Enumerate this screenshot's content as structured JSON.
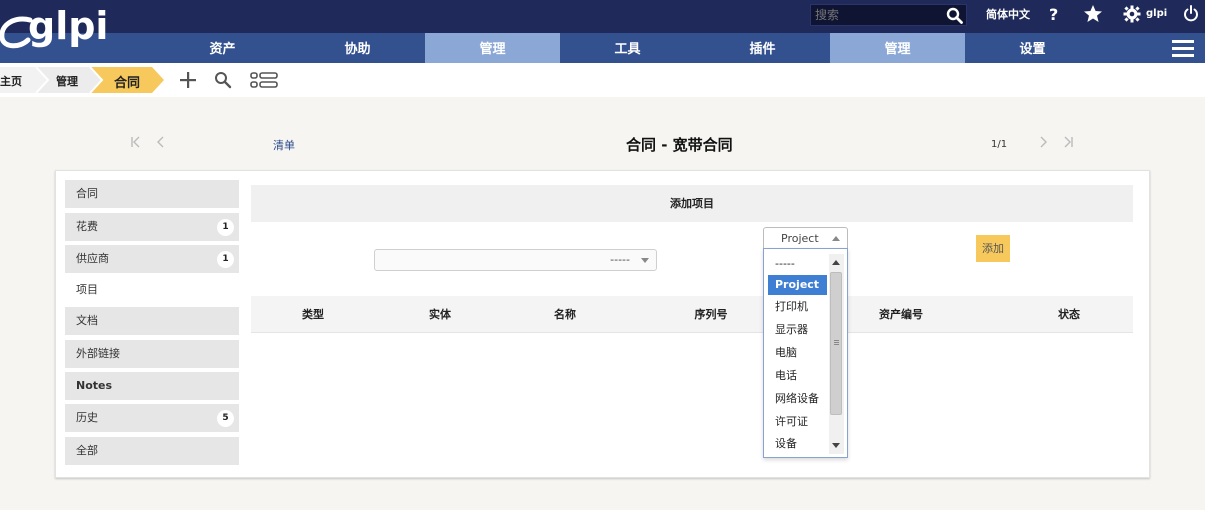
{
  "app": {
    "logo_text": "glpi"
  },
  "topbar": {
    "search_placeholder": "搜索",
    "language": "简体中文",
    "user": "glpi"
  },
  "menu": [
    {
      "label": "资产"
    },
    {
      "label": "协助"
    },
    {
      "label": "管理"
    },
    {
      "label": "工具"
    },
    {
      "label": "插件"
    },
    {
      "label": "管理"
    },
    {
      "label": "设置"
    }
  ],
  "breadcrumb": {
    "home": "主页",
    "section": "管理",
    "current": "合同"
  },
  "nav": {
    "list_link": "清单",
    "title": "合同 - 宽带合同",
    "page_count": "1/1"
  },
  "sidebar": {
    "items": [
      {
        "label": "合同"
      },
      {
        "label": "花费",
        "badge": "1"
      },
      {
        "label": "供应商",
        "badge": "1"
      },
      {
        "label": "项目"
      },
      {
        "label": "文档"
      },
      {
        "label": "外部链接"
      },
      {
        "label": "Notes"
      },
      {
        "label": "历史",
        "badge": "5"
      },
      {
        "label": "全部"
      }
    ]
  },
  "panel": {
    "header": "添加项目",
    "item_select_value": "-----",
    "type_select_value": "Project",
    "add_button": "添加"
  },
  "table": {
    "columns": [
      "类型",
      "实体",
      "名称",
      "序列号",
      "资产编号",
      "状态"
    ]
  },
  "dropdown": {
    "options": [
      "-----",
      "Project",
      "打印机",
      "显示器",
      "电脑",
      "电话",
      "网络设备",
      "许可证",
      "设备"
    ],
    "selected": "Project"
  },
  "colors": {
    "topbar": "#1f2a5a",
    "menubar": "#33508f",
    "menu_active": "#8aa7d6",
    "breadcrumb_active": "#f7c95c",
    "selected_option": "#3e7fd4"
  }
}
